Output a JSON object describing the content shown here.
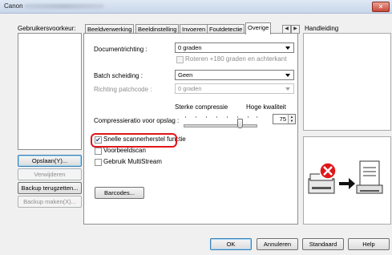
{
  "window": {
    "app_name": "Canon",
    "close_glyph": "✕"
  },
  "left": {
    "user_prefs_label": "Gebruikersvoorkeur:",
    "save_button": "Opslaan(Y)...",
    "delete_button": "Verwijderen",
    "restore_backup_button": "Backup terugzetten...",
    "make_backup_button": "Backup maken(X)..."
  },
  "tabs": [
    {
      "label": "Beeldverwerking",
      "active": false
    },
    {
      "label": "Beeldinstelling",
      "active": false
    },
    {
      "label": "Invoeren",
      "active": false
    },
    {
      "label": "Foutdetectie",
      "active": false
    },
    {
      "label": "Overige",
      "active": true
    }
  ],
  "tab_scroll": {
    "left_glyph": "◀",
    "right_glyph": "▶"
  },
  "panel": {
    "doc_orientation_label": "Documentrichting :",
    "doc_orientation_value": "0 graden",
    "rotate_label": "Roteren +180 graden en achterkant",
    "batch_label": "Batch scheiding :",
    "batch_value": "Geen",
    "patchcode_label": "Richting patchcode :",
    "patchcode_value": "0 graden",
    "compress_high_label": "Sterke compressie",
    "quality_high_label": "Hoge kwaliteit",
    "compression_label": "Compressieratio voor opslag :",
    "compression_value": "75",
    "quick_recovery_label": "Snelle scannerherstel functie",
    "quick_recovery_checked": true,
    "prescan_label": "Voorbeeldscan",
    "prescan_checked": false,
    "multistream_label": "Gebruik MultiStream",
    "multistream_checked": false,
    "barcodes_button": "Barcodes..."
  },
  "right": {
    "manual_label": "Handleiding"
  },
  "footer": {
    "ok": "OK",
    "cancel": "Annuleren",
    "default": "Standaard",
    "help": "Help"
  },
  "illustration": {
    "error_color": "#e0161b",
    "error_glyph": "✕",
    "arrow_glyph": "➡"
  }
}
